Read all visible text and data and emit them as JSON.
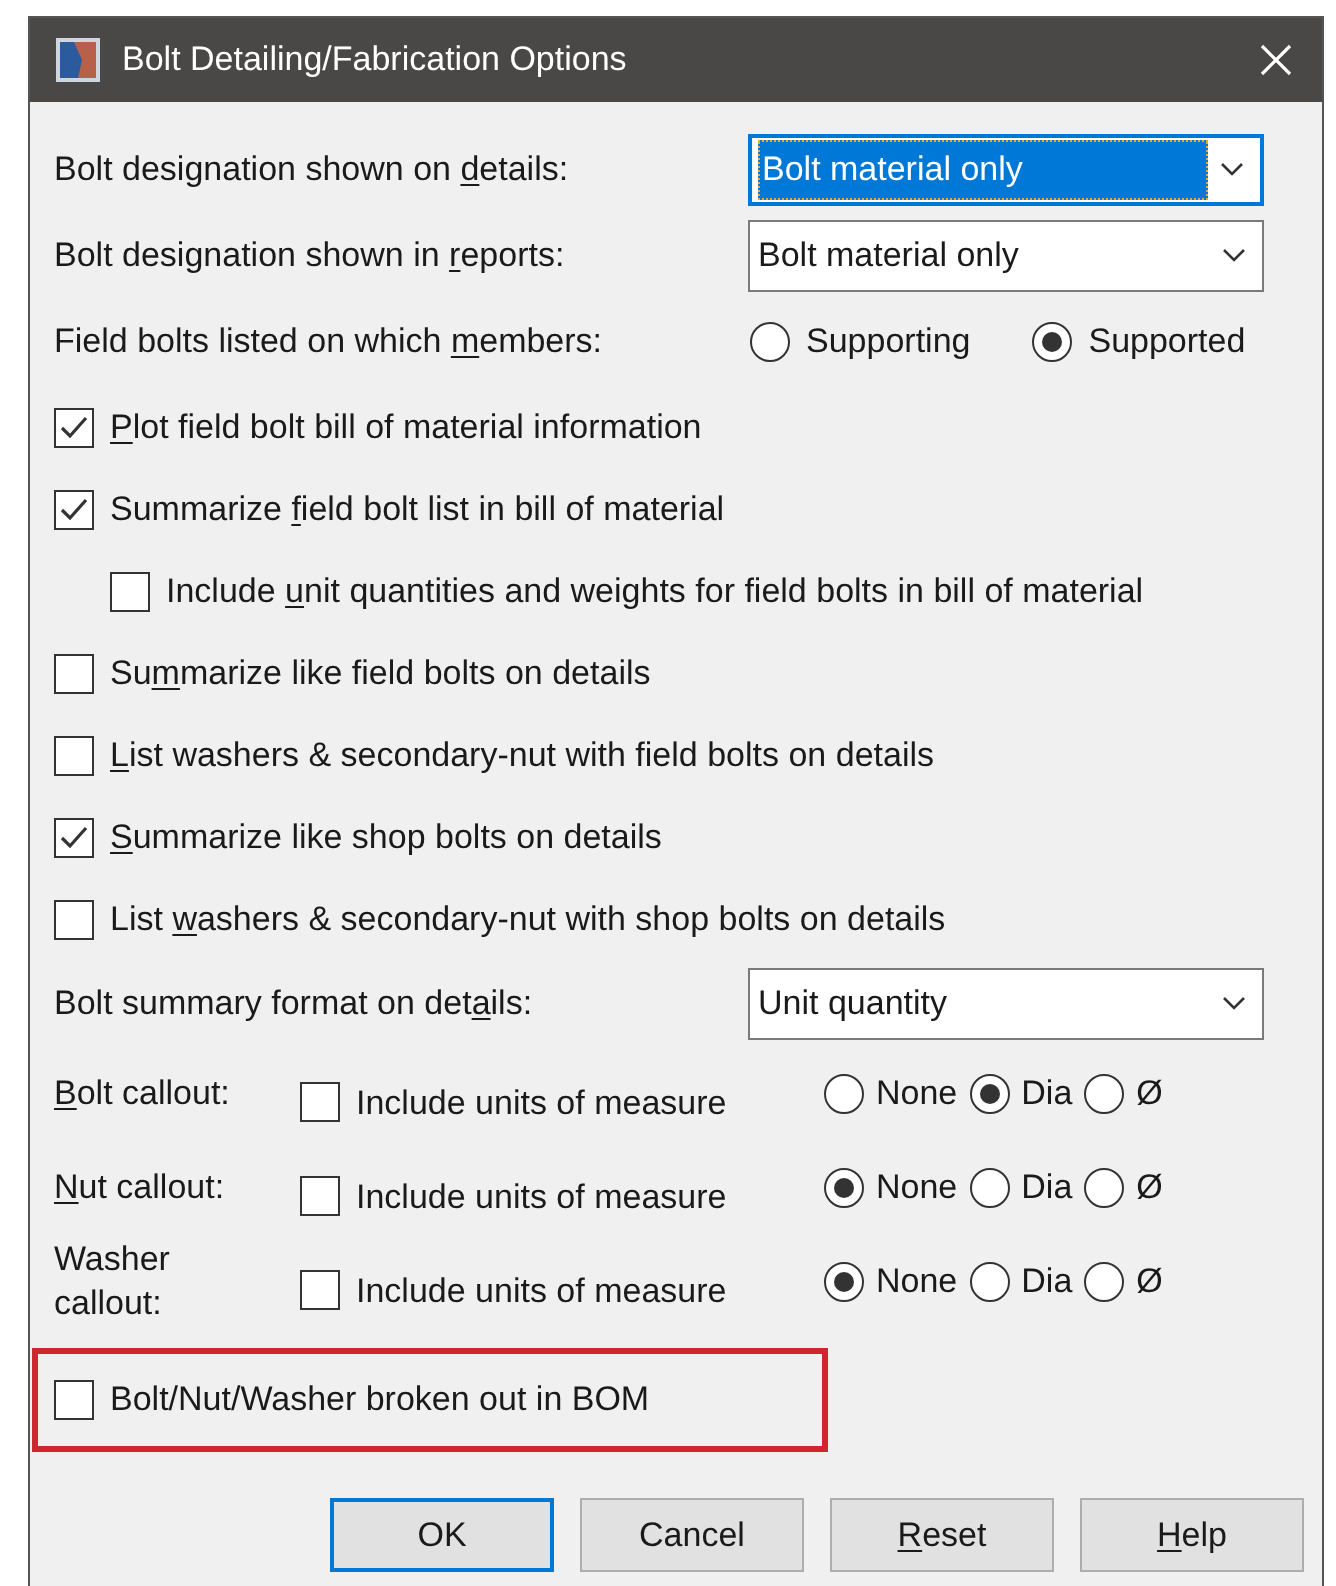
{
  "window": {
    "title": "Bolt Detailing/Fabrication Options"
  },
  "rows": [
    {
      "kind": "dropdown",
      "label": {
        "before": "Bolt designation shown on ",
        "key": "d",
        "after": "etails:"
      },
      "value": "Bolt material only",
      "focused": true
    },
    {
      "kind": "dropdown",
      "label": {
        "before": "Bolt designation shown in ",
        "key": "r",
        "after": "eports:"
      },
      "value": "Bolt material only",
      "focused": false
    },
    {
      "kind": "radio",
      "label": {
        "before": "Field bolts listed on which ",
        "key": "m",
        "after": "embers:"
      },
      "options": [
        {
          "label": "Supporting",
          "selected": false
        },
        {
          "label": "Supported",
          "selected": true
        }
      ]
    },
    {
      "kind": "checkbox",
      "label": {
        "key": "P",
        "after": "lot field bolt bill of material information"
      },
      "checked": true
    },
    {
      "kind": "checkbox",
      "label": {
        "before": "Summarize ",
        "key": "f",
        "after": "ield bolt list in bill of material"
      },
      "checked": true,
      "children": [
        {
          "kind": "checkbox",
          "label": {
            "before": "Include ",
            "key": "u",
            "after": "nit quantities and weights for field bolts in bill of material"
          },
          "checked": false
        }
      ]
    },
    {
      "kind": "checkbox",
      "label": {
        "before": "Su",
        "key": "m",
        "after": "marize like field bolts on details"
      },
      "checked": false
    },
    {
      "kind": "checkbox",
      "label": {
        "key": "L",
        "after": "ist washers & secondary-nut with field bolts on details"
      },
      "checked": false
    },
    {
      "kind": "checkbox",
      "label": {
        "key": "S",
        "after": "ummarize like shop bolts on details"
      },
      "checked": true
    },
    {
      "kind": "checkbox",
      "label": {
        "before": "List ",
        "key": "w",
        "after": "ashers & secondary-nut with shop bolts on details"
      },
      "checked": false
    },
    {
      "kind": "dropdown",
      "label": {
        "before": "Bolt summary format on det",
        "key": "a",
        "after": "ils:"
      },
      "value": "Unit quantity",
      "focused": false
    },
    {
      "kind": "callout",
      "label": {
        "key": "B",
        "after": "olt callout:"
      },
      "checkbox": {
        "label": {
          "before": "Include units of measure"
        },
        "checked": false
      },
      "options": [
        {
          "label": "None",
          "selected": false
        },
        {
          "label": "Dia",
          "selected": true
        },
        {
          "label": "Ø",
          "selected": false
        }
      ]
    },
    {
      "kind": "callout",
      "label": {
        "key": "N",
        "after": "ut callout:"
      },
      "checkbox": {
        "label": {
          "before": "Include units of measure"
        },
        "checked": false
      },
      "options": [
        {
          "label": "None",
          "selected": true
        },
        {
          "label": "Dia",
          "selected": false
        },
        {
          "label": "Ø",
          "selected": false
        }
      ]
    },
    {
      "kind": "callout",
      "label": {
        "before": "Washer callout:"
      },
      "checkbox": {
        "label": {
          "before": "Include units of measure"
        },
        "checked": false
      },
      "options": [
        {
          "label": "None",
          "selected": true
        },
        {
          "label": "Dia",
          "selected": false
        },
        {
          "label": "Ø",
          "selected": false
        }
      ]
    },
    {
      "kind": "checkbox",
      "label": {
        "before": "Bolt/Nut/Washer broken out in BOM"
      },
      "checked": false,
      "highlighted": true
    }
  ],
  "buttons": [
    {
      "label": {
        "before": "OK"
      },
      "default": true
    },
    {
      "label": {
        "before": "Cancel"
      },
      "default": false
    },
    {
      "label": {
        "key": "R",
        "after": "eset"
      },
      "default": false
    },
    {
      "label": {
        "key": "H",
        "after": "elp"
      },
      "default": false
    }
  ]
}
